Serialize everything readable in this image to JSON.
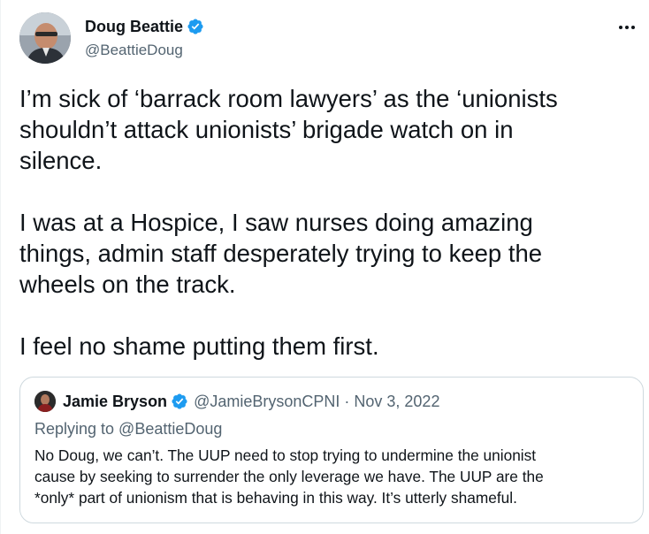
{
  "author": {
    "name": "Doug Beattie",
    "handle": "@BeattieDoug"
  },
  "tweet": {
    "lines": [
      "I’m sick of ‘barrack room lawyers’ as the ‘unionists",
      "shouldn’t attack unionists’ brigade watch on in",
      "silence.",
      "",
      "I was at a Hospice, I saw nurses doing amazing",
      "things, admin staff desperately trying to keep the",
      "wheels on the track.",
      "",
      "I feel no shame putting them first."
    ]
  },
  "quoted": {
    "name": "Jamie Bryson",
    "handle": "@JamieBrysonCPNI",
    "separator": "·",
    "date": "Nov 3, 2022",
    "replying_to": "Replying to @BeattieDoug",
    "lines": [
      "No Doug, we can’t. The UUP need to stop trying to undermine the unionist",
      "cause by seeking to surrender the only leverage we have. The UUP are the",
      "*only* part of unionism that is behaving in this way. It’s utterly shameful."
    ]
  },
  "colors": {
    "verified_blue": "#1d9bf0",
    "secondary_text": "#536471",
    "border": "#cfd9de"
  },
  "icons": {
    "verified": "verified-badge-icon",
    "more": "more-horizontal-icon"
  }
}
